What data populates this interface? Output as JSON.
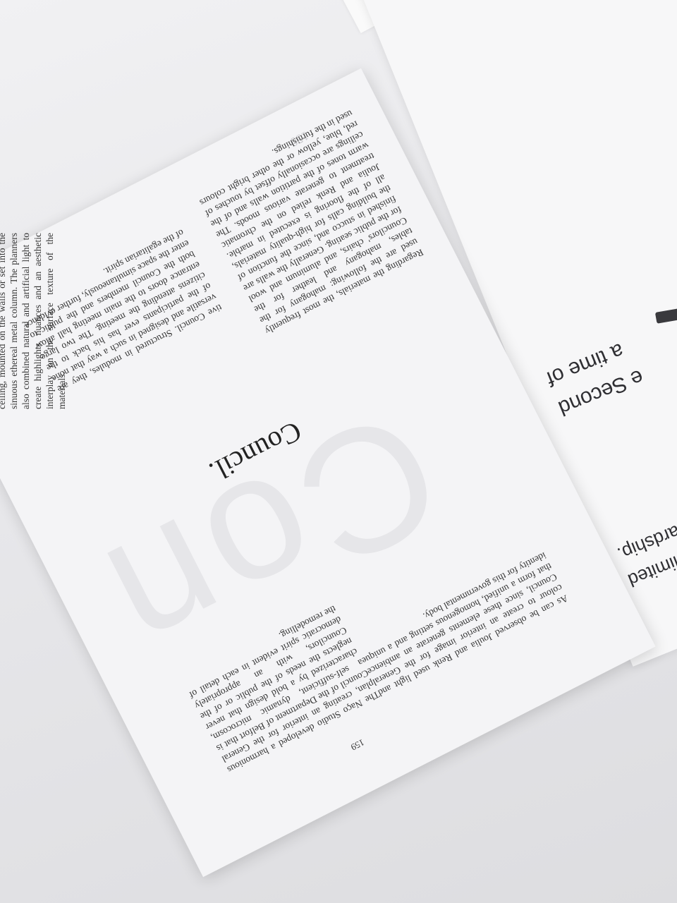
{
  "right_sheet": {
    "line_1": "a time of hardship.",
    "line_2": "oduced with limited",
    "line_3": "a time of",
    "line_4": "e Second"
  },
  "main_page": {
    "heading": "Council.",
    "ghost_letters": "Con",
    "page_number": "159",
    "faint_page_number": "159",
    "column_a": "As can be observed Joulia and Renk used light and colour to create an interior image for the General Council, since these elements generate an ambience that form a unified, homogenous setting and a unique identity for this governmental body.",
    "column_b": "The Naço Studio developed a harmonious plan, creating an interior for the General Council of the Department of Belfort that is a self-sufficient, dynamic microcosm, characterized by a bold design that never neglects the needs of the public or of the Councilors, with an appropriately democratic spirit evident in each detail of the remodelling.",
    "column_c": "tive Council. Structured in modules, they are versatile and designed in such a way that none of the participants ever has his back to the citizens attending the meeting. The two large entrance doors to the main meeting hall allow both the Council members and the public to enter the space simultaneously, further evidence of the egalitarian spirit.",
    "column_d": "Regarding the materials, the most frequently used are the following: mahogany for the tables, mahogany and leather for the Councilors' chairs, and aluminum and wool for the public seating. Generally the walls are finished in stucco and, since the function of the building calls for high-quality materials, all of the flooring is executed in marble. Joulia and Renk relied on the chromatic treatment to generate various moods. The warm tones of the partition walls and of the ceilings are occasionally offset by touches of red, blue, yellow or the other bright colours used in the furnishings.",
    "column_left": "available natural light. Where natural light is deficient or absent, spotlights are set into the ceiling, mounted on the walls or set into the sinuous ethereal metal column. The planners also combined natural and artificial light to create highlights, nuances and an aesthetic interplay on the surface texture of the materials."
  }
}
